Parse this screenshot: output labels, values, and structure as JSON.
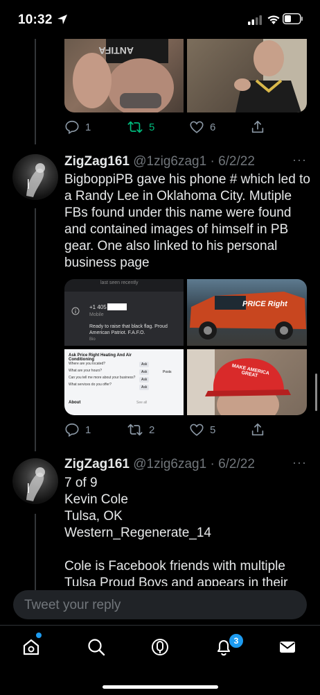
{
  "status_bar": {
    "time": "10:32"
  },
  "tweet_top": {
    "actions": {
      "replies": "1",
      "retweets": "5",
      "likes": "6"
    }
  },
  "tweet_1": {
    "name": "ZigZag161",
    "handle": "@1zig6zag1",
    "separator": "·",
    "date": "6/2/22",
    "more": "···",
    "text": "BigboppiPB gave his phone # which led to a Randy Lee in Oklahoma City. Mutiple FBs found under this name were found and contained images of himself in PB gear. One also linked to his personal business page",
    "media": {
      "profile": {
        "last_seen": "last seen recently",
        "phone": "+1 405",
        "phone_type": "Mobile",
        "bio": "Ready to raise that black flag. Proud American Patriot. F.A.F.O.",
        "bio_label": "Bio"
      },
      "truck": {
        "sign_text": "PRICE Right"
      },
      "page": {
        "title": "Ask Price Right Heating And Air Conditioning",
        "questions": [
          "Where are you located?",
          "What are your hours?",
          "Can you tell me more about your business?",
          "What services do you offer?"
        ],
        "ask_label": "Ask",
        "about_label": "About",
        "see_all": "See all",
        "posts_label": "Posts"
      },
      "selfie": {
        "hat_text": "MAKE AMERICA GREAT"
      }
    },
    "actions": {
      "replies": "1",
      "retweets": "2",
      "likes": "5"
    }
  },
  "tweet_2": {
    "name": "ZigZag161",
    "handle": "@1zig6zag1",
    "separator": "·",
    "date": "6/2/22",
    "more": "···",
    "lines": [
      "7 of 9",
      "Kevin Cole",
      "Tulsa, OK",
      "Western_Regenerate_14",
      "",
      "Cole is Facebook friends with multiple",
      "Tulsa Proud Boys and appears in their"
    ]
  },
  "reply": {
    "placeholder": "Tweet your reply"
  },
  "tab_bar": {
    "items": [
      "home-icon",
      "search-icon",
      "spaces-icon",
      "notifications-icon",
      "messages-icon"
    ],
    "notification_count": "3"
  },
  "colors": {
    "accent": "#1d9bf0",
    "retweet_green": "#00ba7c",
    "muted": "#71767b"
  }
}
